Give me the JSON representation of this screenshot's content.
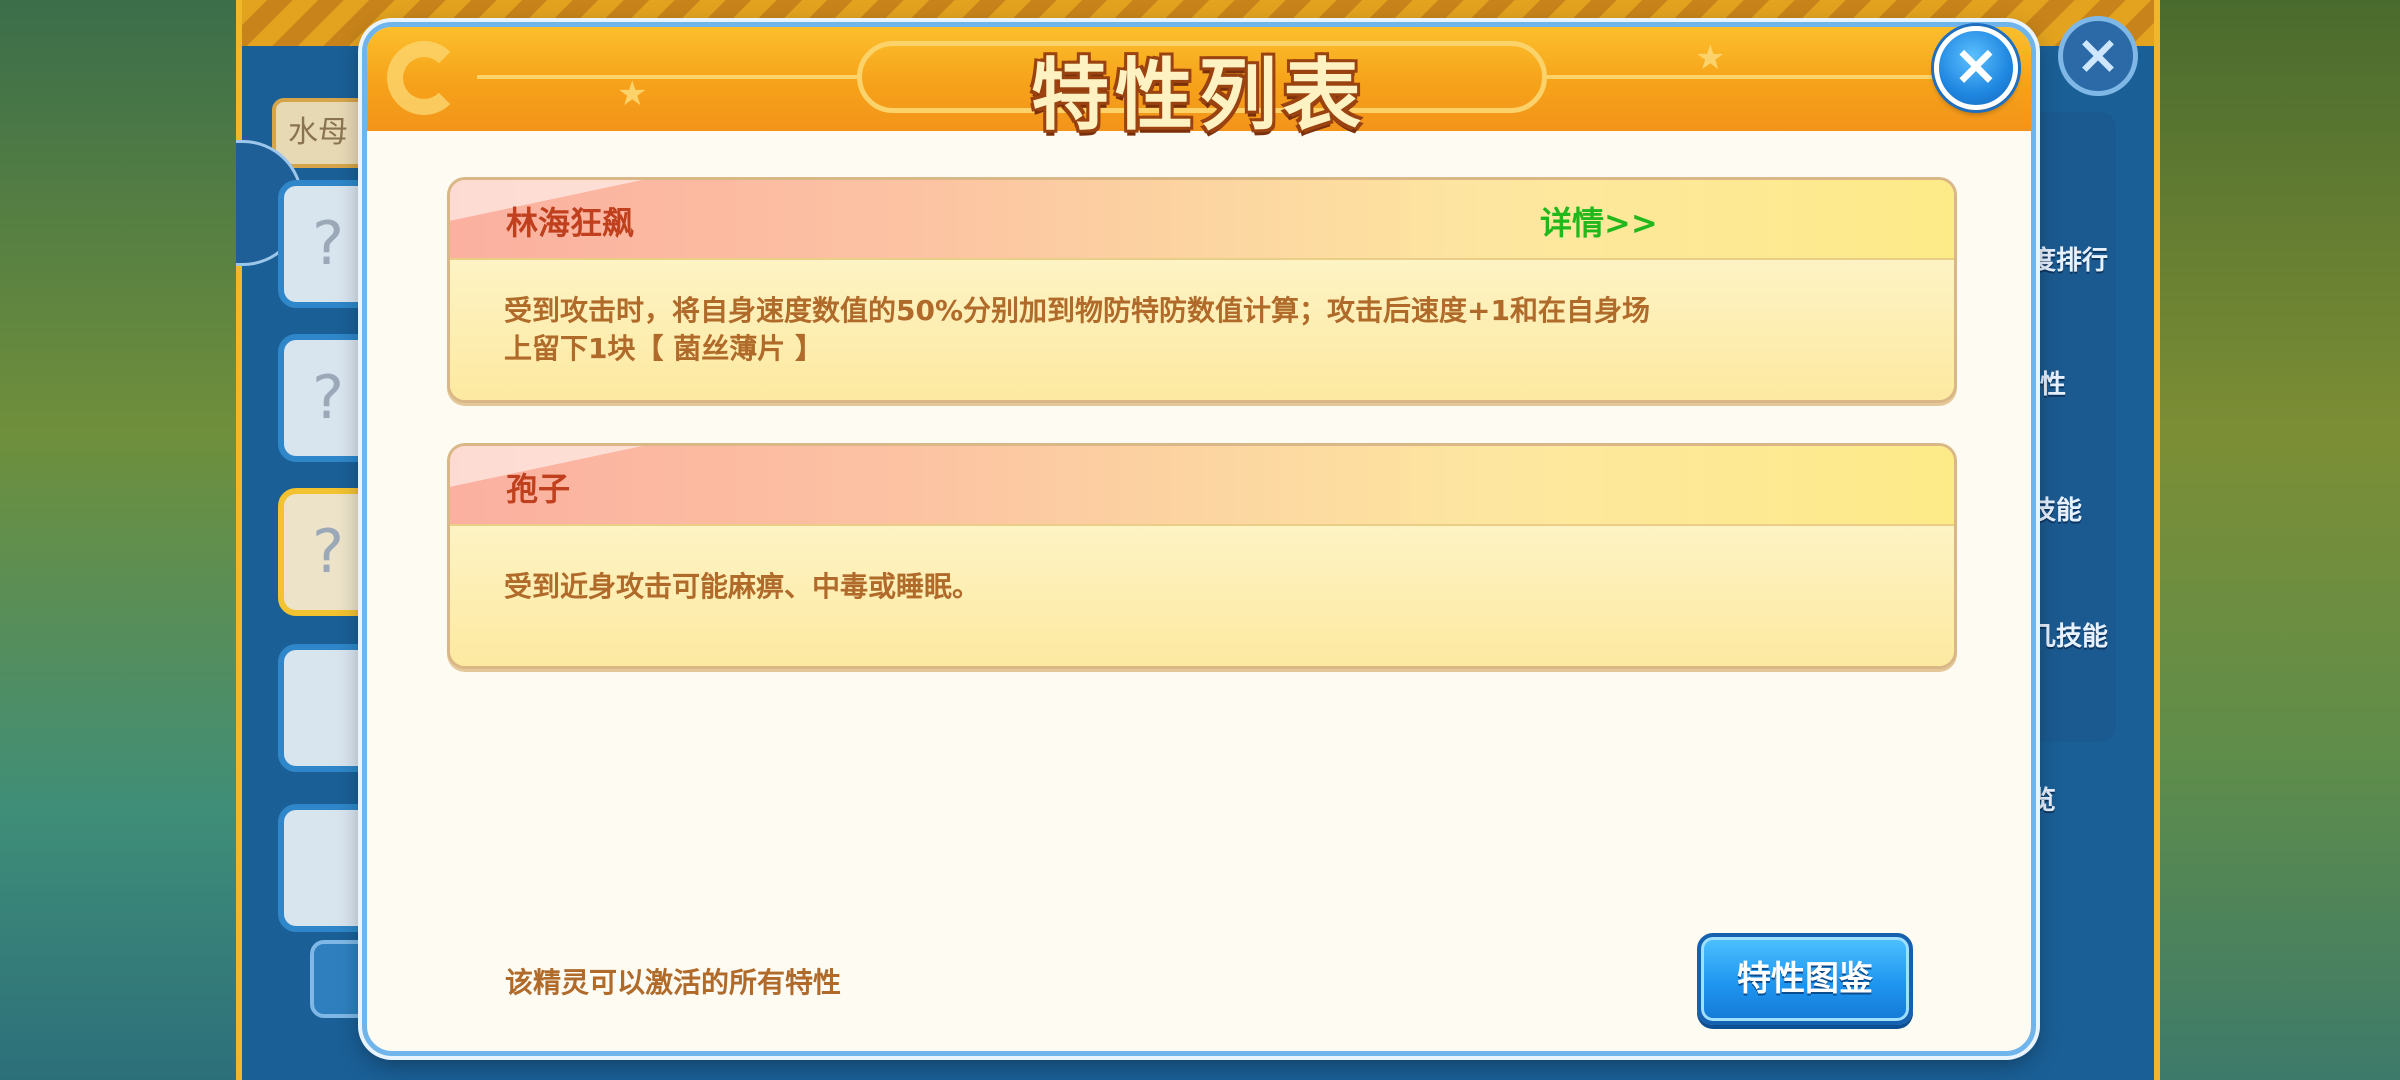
{
  "modal": {
    "title": "特性列表",
    "close_icon": "×",
    "traits": [
      {
        "name": "林海狂飙",
        "detail_link": "详情>>",
        "description_line1": "受到攻击时，将自身速度数值的50%分别加到物防特防数值计算；攻击后速度+1和在自身场",
        "description_line2": "上留下1块【 菌丝薄片 】"
      },
      {
        "name": "孢子",
        "description_line1": "受到近身攻击可能麻痹、中毒或睡眠。"
      }
    ],
    "footer_note": "该精灵可以激活的所有特性",
    "codex_button": "特性图鉴"
  },
  "background": {
    "search_text": "水母",
    "close_icon": "×",
    "slot_glyph": "?",
    "menu_labels": [
      "度排行",
      "性",
      "技能",
      "几技能",
      "览"
    ]
  },
  "colors": {
    "header_orange": "#f6a21a",
    "title_outline": "#9b4310",
    "trait_name": "#c0401e",
    "detail_link": "#22b81c",
    "body_text": "#b06a2a",
    "button_blue": "#1f96f0"
  }
}
